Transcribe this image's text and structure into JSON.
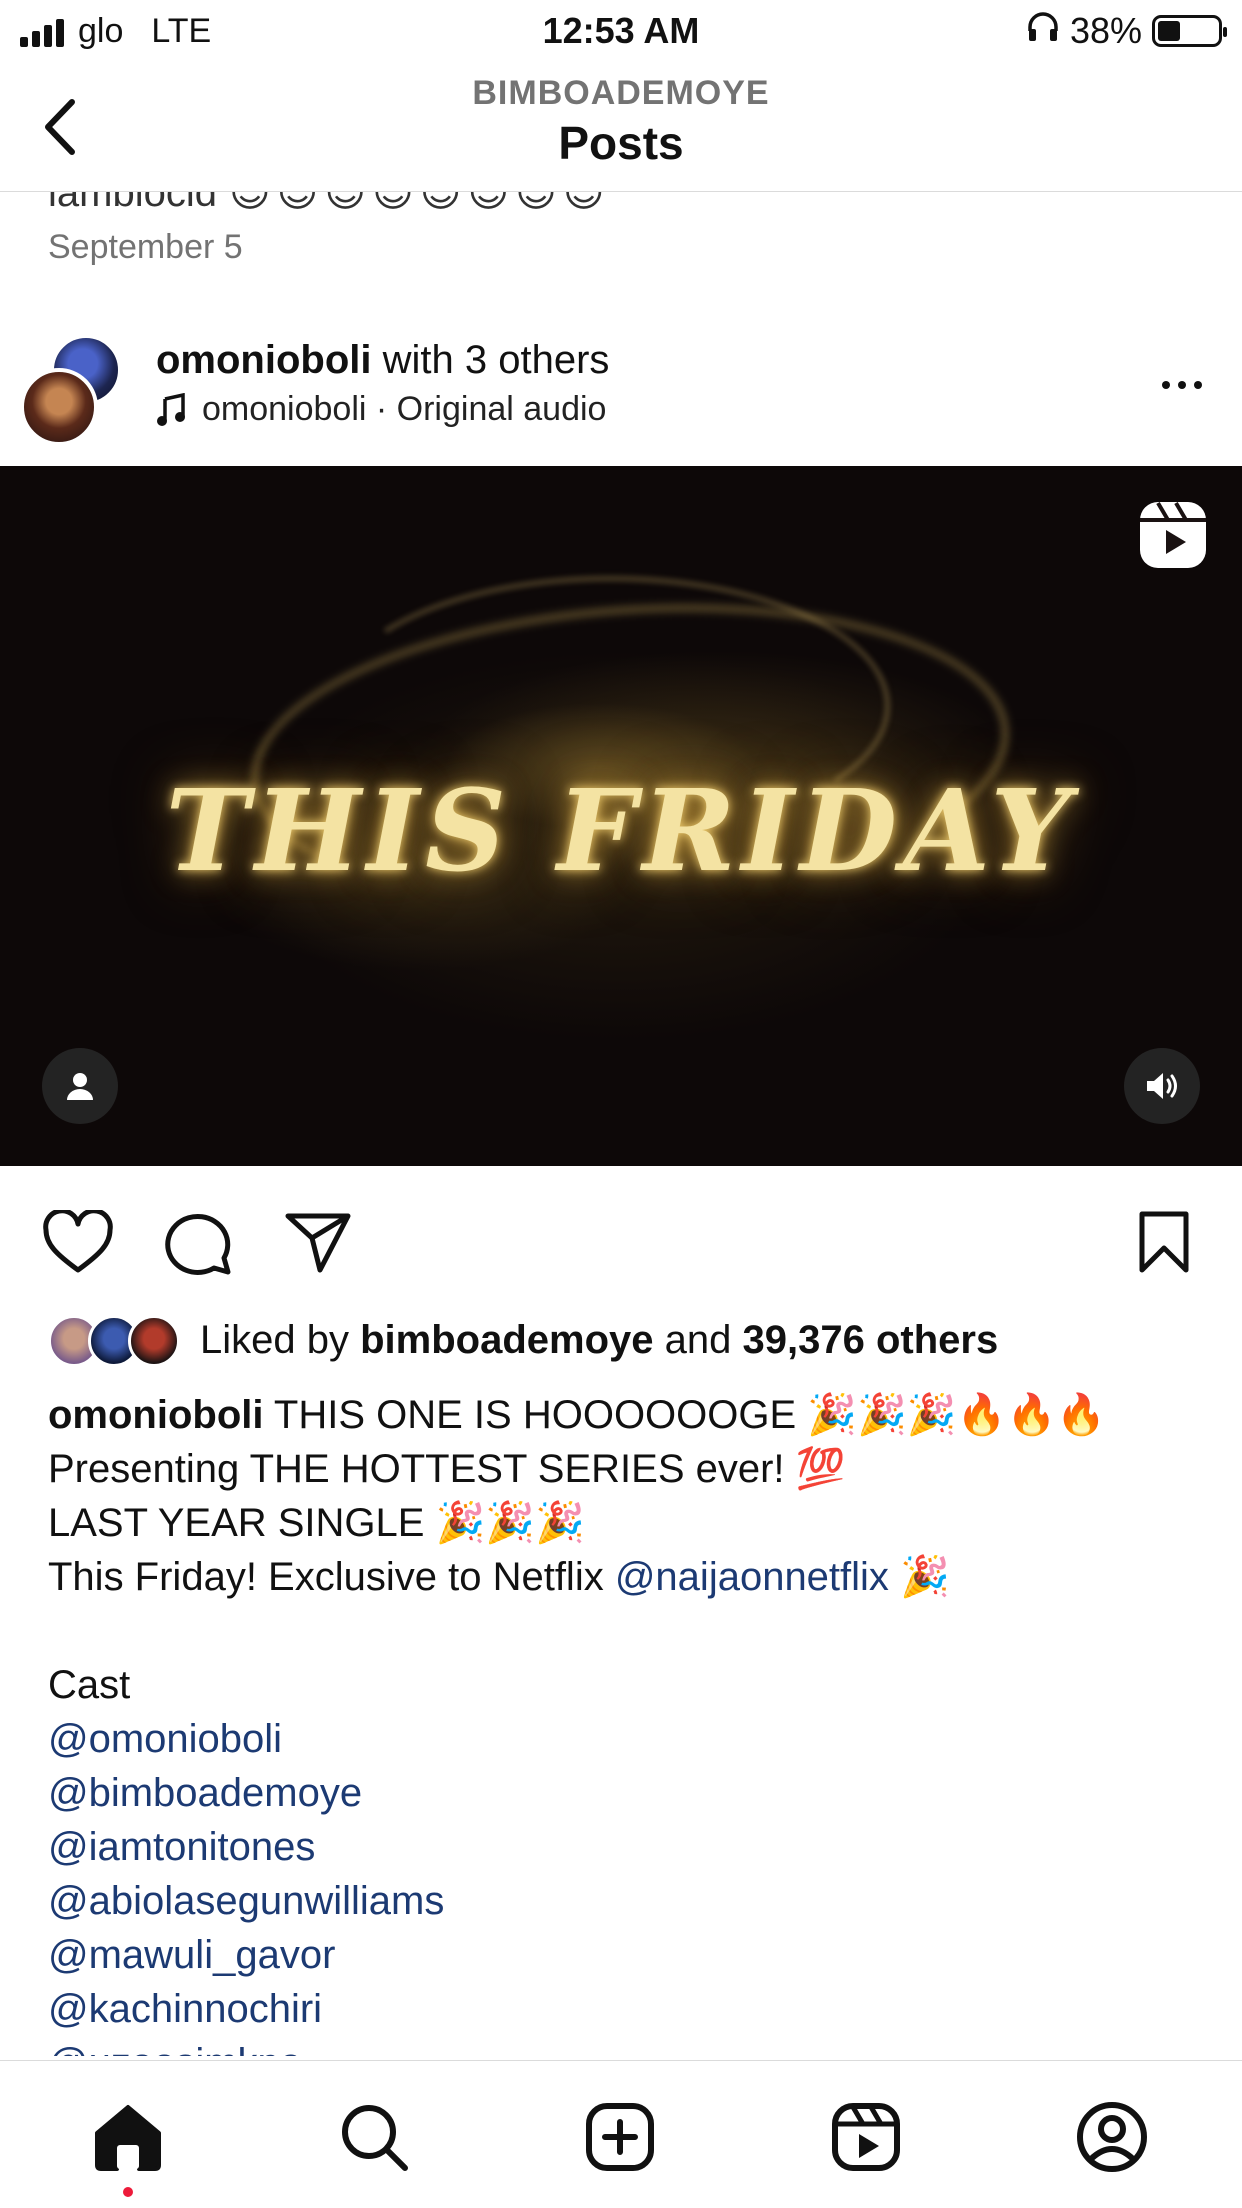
{
  "status_bar": {
    "carrier": "glo",
    "network": "LTE",
    "time": "12:53 AM",
    "battery": "38%",
    "battery_level": 0.38,
    "icons": [
      "signal-icon",
      "headphones-icon",
      "battery-icon"
    ]
  },
  "header": {
    "username": "BIMBOADEMOYE",
    "title": "Posts",
    "icons": [
      "back-arrow-icon"
    ]
  },
  "previous_post": {
    "caption_fragment": "iamblocid",
    "emojis": "😇😇😇😇😇😇😇😇",
    "date": "September 5"
  },
  "post": {
    "username": "omonioboli",
    "with_text": "with 3 others",
    "audio_label": "omonioboli · Original audio",
    "media_text": "THIS FRIDAY",
    "likes_prefix": "Liked by",
    "liked_by_user": "bimboademoye",
    "likes_and": "and",
    "likes_others": "39,376 others",
    "caption": {
      "author": "omonioboli",
      "line1": "THIS ONE IS HOOOOOOGE 🎉🎉🎉🔥🔥🔥",
      "line2": "Presenting THE HOTTEST SERIES ever! 💯",
      "line3": "LAST YEAR SINGLE 🎉🎉🎉",
      "line4_text": "This Friday!  Exclusive to Netflix",
      "line4_mention": "@naijaonnetflix",
      "line4_emoji": "🎉",
      "cast_heading": "Cast",
      "cast": [
        "@omonioboli",
        "@bimboademoye",
        "@iamtonitones",
        "@abiolasegunwilliams",
        "@mawuli_gavor",
        "@kachinnochiri",
        "@uzoosimkpa"
      ]
    }
  },
  "bottom_nav": {
    "items": [
      "home",
      "search",
      "create",
      "reels",
      "profile"
    ],
    "active": "home"
  },
  "colors": {
    "mention": "#1c3a73",
    "notification_dot": "#ed1b3a",
    "secondary_text": "#737373",
    "divider": "#dbdbdb"
  }
}
